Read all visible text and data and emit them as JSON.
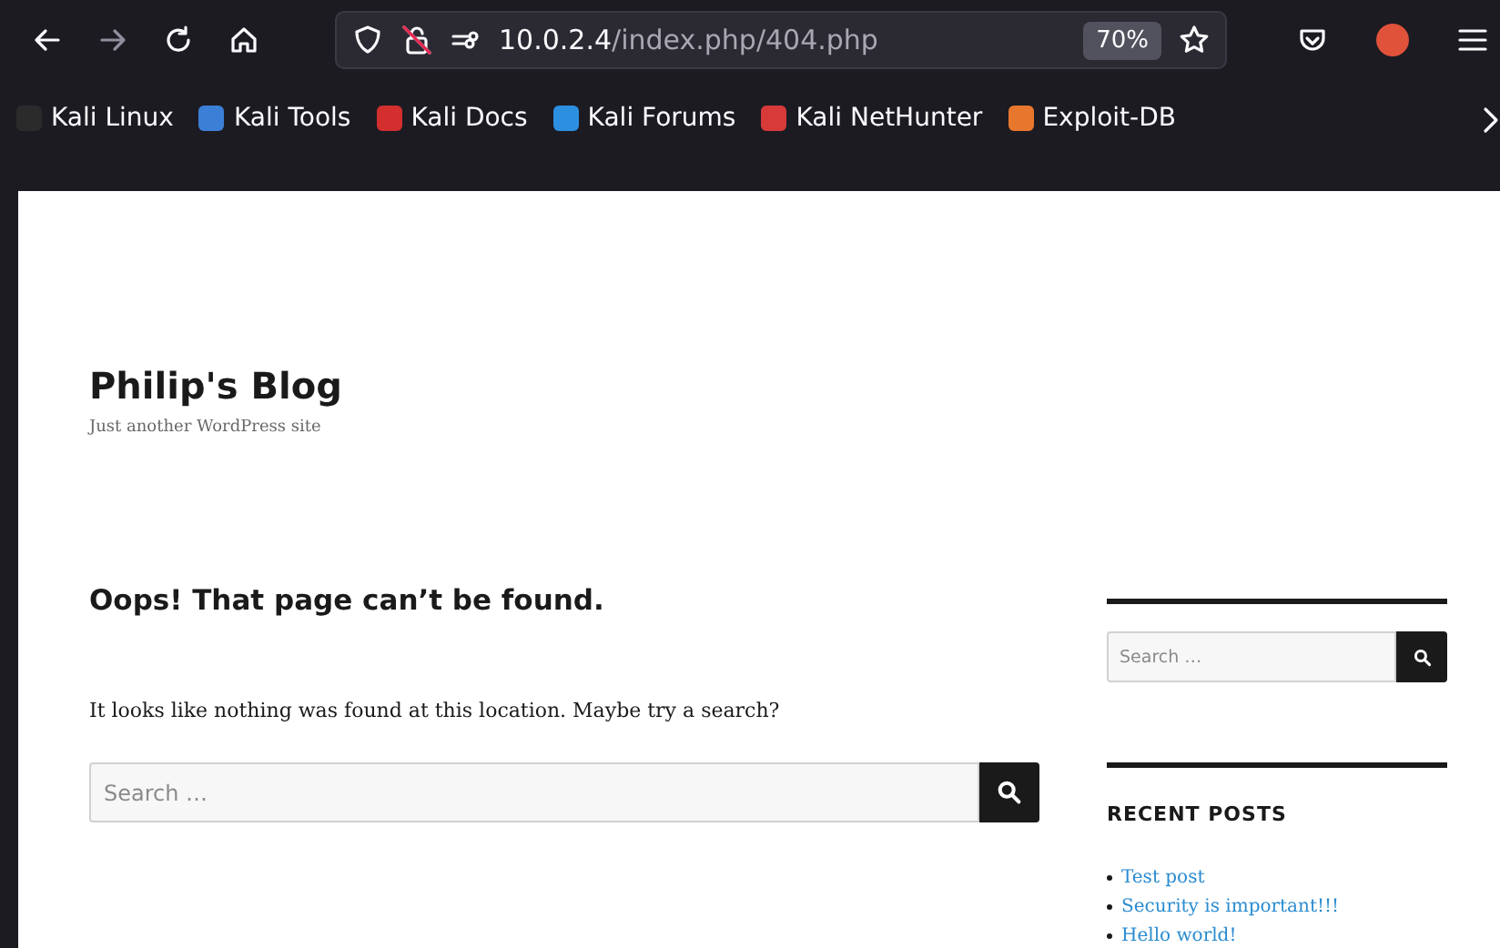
{
  "browser": {
    "url_host": "10.0.2.4",
    "url_path": "/index.php/404.php",
    "zoom": "70%"
  },
  "bookmarks": [
    {
      "label": "Kali Linux",
      "color": "#2b2b2b"
    },
    {
      "label": "Kali Tools",
      "color": "#3b7fd6"
    },
    {
      "label": "Kali Docs",
      "color": "#d32f2f"
    },
    {
      "label": "Kali Forums",
      "color": "#2d8fe0"
    },
    {
      "label": "Kali NetHunter",
      "color": "#d83a3a"
    },
    {
      "label": "Exploit-DB",
      "color": "#e8772e"
    }
  ],
  "site": {
    "title": "Philip's Blog",
    "tagline": "Just another WordPress site"
  },
  "content": {
    "heading": "Oops! That page can’t be found.",
    "message": "It looks like nothing was found at this location. Maybe try a search?",
    "search": {
      "placeholder": "Search …"
    }
  },
  "sidebar": {
    "search": {
      "placeholder": "Search …"
    },
    "recent_posts": {
      "title": "RECENT POSTS",
      "items": [
        "Test post",
        "Security is important!!!",
        "Hello world!"
      ]
    }
  }
}
